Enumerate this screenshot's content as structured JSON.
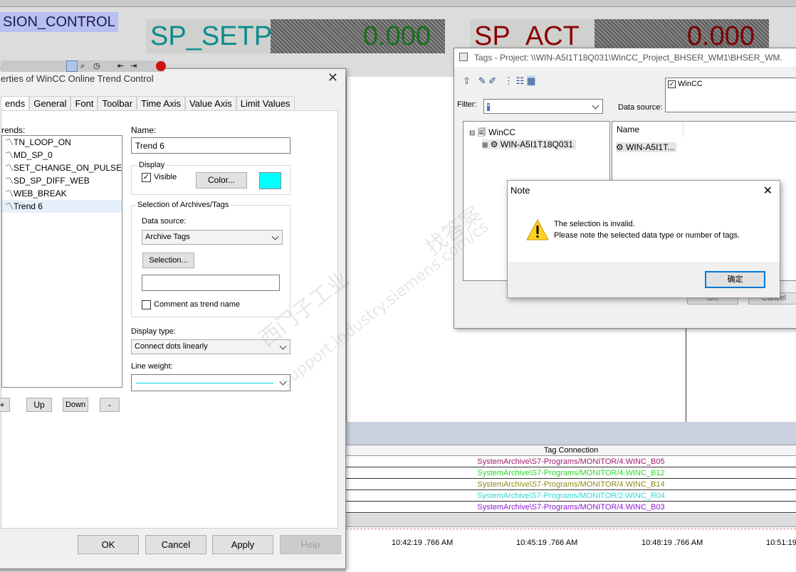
{
  "runtime": {
    "system_label": "SION_CONTROL",
    "sp_setp_label": "SP_SETP",
    "sp_setp_value": "0.000",
    "sp_act_label": "SP_ACT",
    "sp_act_value": "0.000",
    "table_header": "Tag Connection",
    "table_rows": [
      {
        "text": "SystemArchive\\S7-Programs/MONITOR/4.WINC_B05",
        "color": "#9b1a6b"
      },
      {
        "text": "SystemArchive\\S7-Programs/MONITOR/4.WINC_B12",
        "color": "#2bd42b"
      },
      {
        "text": "SystemArchive\\S7-Programs/MONITOR/4.WINC_B14",
        "color": "#8a8a1a"
      },
      {
        "text": "SystemArchive\\S7-Programs/MONITOR/2.WINC_R04",
        "color": "#2cd6d6"
      },
      {
        "text": "SystemArchive\\S7-Programs/MONITOR/4.WINC_B03",
        "color": "#8a1ad0"
      }
    ],
    "time_ticks": [
      "10:42:19 .766 AM",
      "10:45:19 .766 AM",
      "10:48:19 .766 AM",
      "10:51:19"
    ]
  },
  "props": {
    "title": "erties of WinCC Online Trend Control",
    "tabs": [
      "ends",
      "General",
      "Font",
      "Toolbar",
      "Time Axis",
      "Value Axis",
      "Limit Values"
    ],
    "trends_label": "rends:",
    "trends": [
      "TN_LOOP_ON",
      "MD_SP_0",
      "SET_CHANGE_ON_PULSE",
      "SD_SP_DIFF_WEB",
      "WEB_BREAK",
      "Trend 6"
    ],
    "name_label": "Name:",
    "name_value": "Trend 6",
    "display_group": "Display",
    "visible_label": "Visible",
    "color_button": "Color...",
    "swatch_color": "#00ffff",
    "selection_group": "Selection of Archives/Tags",
    "data_source_label": "Data source:",
    "data_source_value": "Archive Tags",
    "selection_button": "Selection...",
    "comment_label": "Comment as trend name",
    "display_type_label": "Display type:",
    "display_type_value": "Connect dots linearly",
    "line_weight_label": "Line weight:",
    "list_buttons": [
      "+",
      "Up",
      "Down",
      "-"
    ],
    "ok": "OK",
    "cancel": "Cancel",
    "apply": "Apply",
    "help": "Help"
  },
  "tags": {
    "title": "Tags - Project: \\\\WIN-A5I1T18Q031\\WinCC_Project_BHSER_WM1\\BHSER_WM.",
    "filter_label": "Filter:",
    "filter_value": "*",
    "data_source_label": "Data source:",
    "data_source_item": "WinCC",
    "tree_root": "WinCC",
    "tree_child": "WIN-A5I1T18Q031",
    "list_header": "Name",
    "list_item": "WIN-A5I1T...",
    "ok_partial": "OK",
    "cancel_partial": "Cancel"
  },
  "note": {
    "title": "Note",
    "line1": "The selection is invalid.",
    "line2": "Please note the selected data type or number of tags.",
    "ok": "确定"
  },
  "watermark": {
    "line1": "西门子工业",
    "line2": "support.industry.siemens.com/cs",
    "line3": "找答案"
  }
}
